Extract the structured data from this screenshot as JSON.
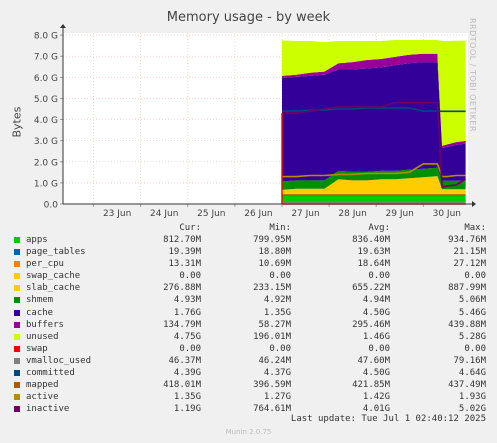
{
  "page": {
    "title": "Memory usage - by week",
    "side_credit": "RRDTOOL / TOBI OETIKER",
    "ylabel": "Bytes",
    "last_update": "Last update:  Tue Jul  1 02:40:12 2025",
    "footer": "Munin 2.0.75"
  },
  "legend": {
    "headers": [
      "Cur:",
      "Min:",
      "Avg:",
      "Max:"
    ],
    "rows": [
      {
        "name": "apps",
        "color": "#00cc00",
        "cur": "812.70M",
        "min": "799.95M",
        "avg": "836.40M",
        "max": "934.76M"
      },
      {
        "name": "page_tables",
        "color": "#0066b3",
        "cur": "19.39M",
        "min": "18.80M",
        "avg": "19.63M",
        "max": "21.15M"
      },
      {
        "name": "per_cpu",
        "color": "#ff8000",
        "cur": "13.31M",
        "min": "10.69M",
        "avg": "18.64M",
        "max": "27.12M"
      },
      {
        "name": "swap_cache",
        "color": "#ffcc00",
        "cur": "0.00",
        "min": "0.00",
        "avg": "0.00",
        "max": "0.00"
      },
      {
        "name": "slab_cache",
        "color": "#ffcc00",
        "cur": "276.88M",
        "min": "233.15M",
        "avg": "655.22M",
        "max": "887.99M"
      },
      {
        "name": "shmem",
        "color": "#008f00",
        "cur": "4.93M",
        "min": "4.92M",
        "avg": "4.94M",
        "max": "5.06M"
      },
      {
        "name": "cache",
        "color": "#330099",
        "cur": "1.76G",
        "min": "1.35G",
        "avg": "4.50G",
        "max": "5.46G"
      },
      {
        "name": "buffers",
        "color": "#990099",
        "cur": "134.79M",
        "min": "58.27M",
        "avg": "295.46M",
        "max": "439.88M"
      },
      {
        "name": "unused",
        "color": "#ccff00",
        "cur": "4.75G",
        "min": "196.01M",
        "avg": "1.46G",
        "max": "5.28G"
      },
      {
        "name": "swap",
        "color": "#ff0000",
        "cur": "0.00",
        "min": "0.00",
        "avg": "0.00",
        "max": "0.00"
      },
      {
        "name": "vmalloc_used",
        "color": "#808080",
        "cur": "46.37M",
        "min": "46.24M",
        "avg": "47.60M",
        "max": "79.16M"
      },
      {
        "name": "committed",
        "color": "#00487d",
        "cur": "4.39G",
        "min": "4.37G",
        "avg": "4.50G",
        "max": "4.64G"
      },
      {
        "name": "mapped",
        "color": "#b35a00",
        "cur": "418.01M",
        "min": "396.59M",
        "avg": "421.85M",
        "max": "437.49M"
      },
      {
        "name": "active",
        "color": "#b38f00",
        "cur": "1.35G",
        "min": "1.27G",
        "avg": "1.42G",
        "max": "1.93G"
      },
      {
        "name": "inactive",
        "color": "#6b006b",
        "cur": "1.19G",
        "min": "764.61M",
        "avg": "4.01G",
        "max": "5.02G"
      }
    ]
  },
  "chart_data": {
    "type": "area",
    "title": "Memory usage - by week",
    "ylabel": "Bytes",
    "xlabel": "",
    "x_ticks": [
      "23 Jun",
      "24 Jun",
      "25 Jun",
      "26 Jun",
      "27 Jun",
      "28 Jun",
      "29 Jun",
      "30 Jun"
    ],
    "y_ticks": [
      "0.0",
      "1.0 G",
      "2.0 G",
      "3.0 G",
      "4.0 G",
      "5.0 G",
      "6.0 G",
      "7.0 G",
      "8.0 G"
    ],
    "ylim": [
      0,
      8.1
    ],
    "x_range_days": [
      22.35,
      30.95
    ],
    "grid": true,
    "x": [
      27.0,
      27.3,
      27.6,
      27.9,
      28.2,
      28.5,
      28.8,
      29.1,
      29.4,
      29.7,
      30.0,
      30.3,
      30.4,
      30.5,
      30.7,
      30.9
    ],
    "stacked_series": [
      {
        "name": "apps",
        "color": "#00cc00",
        "values": [
          0.38,
          0.38,
          0.38,
          0.38,
          0.38,
          0.38,
          0.38,
          0.38,
          0.38,
          0.38,
          0.38,
          0.38,
          0.38,
          0.38,
          0.38,
          0.38
        ]
      },
      {
        "name": "page_tables",
        "color": "#0066b3",
        "values": [
          0.02,
          0.02,
          0.02,
          0.02,
          0.02,
          0.02,
          0.02,
          0.02,
          0.02,
          0.02,
          0.02,
          0.02,
          0.02,
          0.02,
          0.02,
          0.02
        ]
      },
      {
        "name": "per_cpu",
        "color": "#ff8000",
        "values": [
          0.02,
          0.02,
          0.02,
          0.02,
          0.02,
          0.02,
          0.02,
          0.02,
          0.02,
          0.02,
          0.02,
          0.02,
          0.02,
          0.02,
          0.02,
          0.02
        ]
      },
      {
        "name": "swap_cache",
        "color": "#ffcc00",
        "values": [
          0,
          0,
          0,
          0,
          0,
          0,
          0,
          0,
          0,
          0,
          0,
          0,
          0,
          0,
          0,
          0
        ]
      },
      {
        "name": "slab_cache",
        "color": "#ffcc00",
        "values": [
          0.25,
          0.3,
          0.3,
          0.3,
          0.75,
          0.7,
          0.7,
          0.75,
          0.75,
          0.8,
          0.85,
          0.9,
          0.28,
          0.28,
          0.28,
          0.28
        ]
      },
      {
        "name": "shmem",
        "color": "#008f00",
        "values": [
          0.4,
          0.4,
          0.4,
          0.4,
          0.4,
          0.4,
          0.4,
          0.4,
          0.4,
          0.4,
          0.4,
          0.4,
          0.4,
          0.4,
          0.4,
          0.4
        ]
      },
      {
        "name": "cache",
        "color": "#330099",
        "values": [
          4.9,
          4.9,
          4.95,
          5.0,
          4.8,
          4.85,
          4.9,
          4.9,
          5.0,
          5.05,
          5.05,
          5.0,
          1.55,
          1.6,
          1.7,
          1.76
        ]
      },
      {
        "name": "buffers",
        "color": "#990099",
        "values": [
          0.1,
          0.1,
          0.15,
          0.15,
          0.3,
          0.35,
          0.4,
          0.4,
          0.4,
          0.4,
          0.4,
          0.4,
          0.1,
          0.12,
          0.13,
          0.13
        ]
      },
      {
        "name": "unused",
        "color": "#ccff00",
        "values": [
          1.68,
          1.6,
          1.5,
          1.4,
          1.05,
          1.0,
          0.9,
          0.85,
          0.8,
          0.7,
          0.65,
          0.65,
          4.97,
          4.9,
          4.8,
          4.75
        ]
      }
    ],
    "line_series": [
      {
        "name": "swap",
        "color": "#ff0000",
        "values": [
          0,
          0,
          0,
          0,
          0,
          0,
          0,
          0,
          0,
          0,
          0,
          0,
          0,
          0,
          0,
          0
        ]
      },
      {
        "name": "vmalloc_used",
        "color": "#808080",
        "values": [
          0.05,
          0.05,
          0.05,
          0.05,
          0.05,
          0.05,
          0.05,
          0.05,
          0.05,
          0.05,
          0.05,
          0.05,
          0.05,
          0.05,
          0.05,
          0.05
        ]
      },
      {
        "name": "committed",
        "color": "#00487d",
        "values": [
          4.4,
          4.4,
          4.45,
          4.45,
          4.5,
          4.5,
          4.55,
          4.55,
          4.55,
          4.55,
          4.4,
          4.4,
          4.39,
          4.39,
          4.39,
          4.39
        ]
      },
      {
        "name": "mapped",
        "color": "#b35a00",
        "values": [
          0.42,
          0.42,
          0.42,
          0.42,
          0.42,
          0.42,
          0.42,
          0.42,
          0.42,
          0.42,
          0.42,
          0.42,
          0.42,
          0.42,
          0.42,
          0.42
        ]
      },
      {
        "name": "active",
        "color": "#b38f00",
        "values": [
          1.3,
          1.3,
          1.35,
          1.35,
          1.4,
          1.4,
          1.45,
          1.45,
          1.45,
          1.5,
          1.9,
          1.9,
          1.3,
          1.3,
          1.35,
          1.35
        ]
      },
      {
        "name": "inactive",
        "color": "#6b006b",
        "values": [
          4.3,
          4.3,
          4.4,
          4.5,
          4.6,
          4.6,
          4.6,
          4.6,
          4.8,
          4.8,
          4.8,
          4.8,
          0.8,
          0.85,
          0.9,
          1.19
        ]
      }
    ],
    "special_lines": {
      "swap_red_edges": {
        "color": "#ff0000"
      }
    }
  }
}
